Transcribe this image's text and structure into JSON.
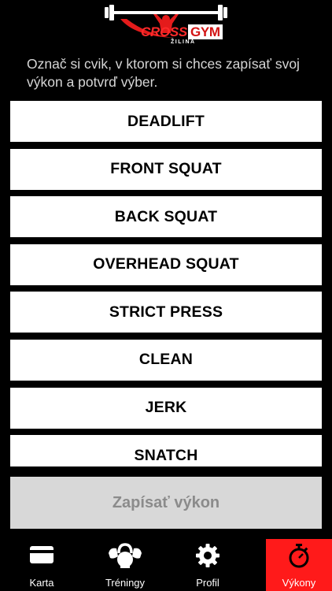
{
  "header": {
    "logo": {
      "brand_part1": "CROSS",
      "brand_part2": "GYM",
      "city": "ŽILINA"
    }
  },
  "instruction": "Označ si cvik, v ktorom si chces zapísať svoj výkon a  potvrď výber.",
  "exercises": [
    {
      "label": "DEADLIFT"
    },
    {
      "label": "FRONT SQUAT"
    },
    {
      "label": "BACK SQUAT"
    },
    {
      "label": "OVERHEAD SQUAT"
    },
    {
      "label": "STRICT PRESS"
    },
    {
      "label": "CLEAN"
    },
    {
      "label": "JERK"
    },
    {
      "label": "SNATCH"
    }
  ],
  "submit_label": "Zapísať výkon",
  "tabs": [
    {
      "label": "Karta",
      "icon": "card-icon"
    },
    {
      "label": "Tréningy",
      "icon": "kettlebell-icon"
    },
    {
      "label": "Profil",
      "icon": "gear-icon"
    },
    {
      "label": "Výkony",
      "icon": "stopwatch-icon",
      "active": true
    }
  ],
  "colors": {
    "background": "#000000",
    "accent": "#ff1a1a",
    "button_bg": "#ffffff",
    "button_disabled_bg": "#d8d8d8",
    "button_disabled_text": "#8b8b8b"
  }
}
